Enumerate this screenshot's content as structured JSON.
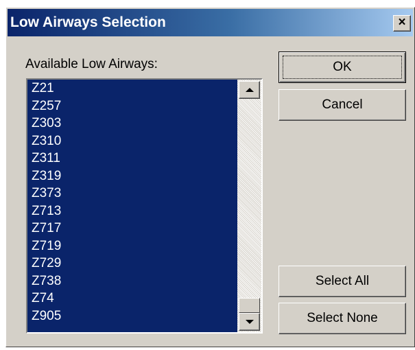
{
  "dialog": {
    "title": "Low Airways Selection",
    "close_label": "×"
  },
  "list": {
    "label": "Available Low Airways:",
    "items": [
      "Z21",
      "Z257",
      "Z303",
      "Z310",
      "Z311",
      "Z319",
      "Z373",
      "Z713",
      "Z717",
      "Z719",
      "Z729",
      "Z738",
      "Z74",
      "Z905"
    ],
    "all_selected": true,
    "selection_color": "#0a246a"
  },
  "buttons": {
    "ok": "OK",
    "cancel": "Cancel",
    "select_all": "Select All",
    "select_none": "Select None"
  },
  "icons": {
    "scroll_up": "up-arrow-icon",
    "scroll_down": "down-arrow-icon",
    "close": "close-icon"
  }
}
